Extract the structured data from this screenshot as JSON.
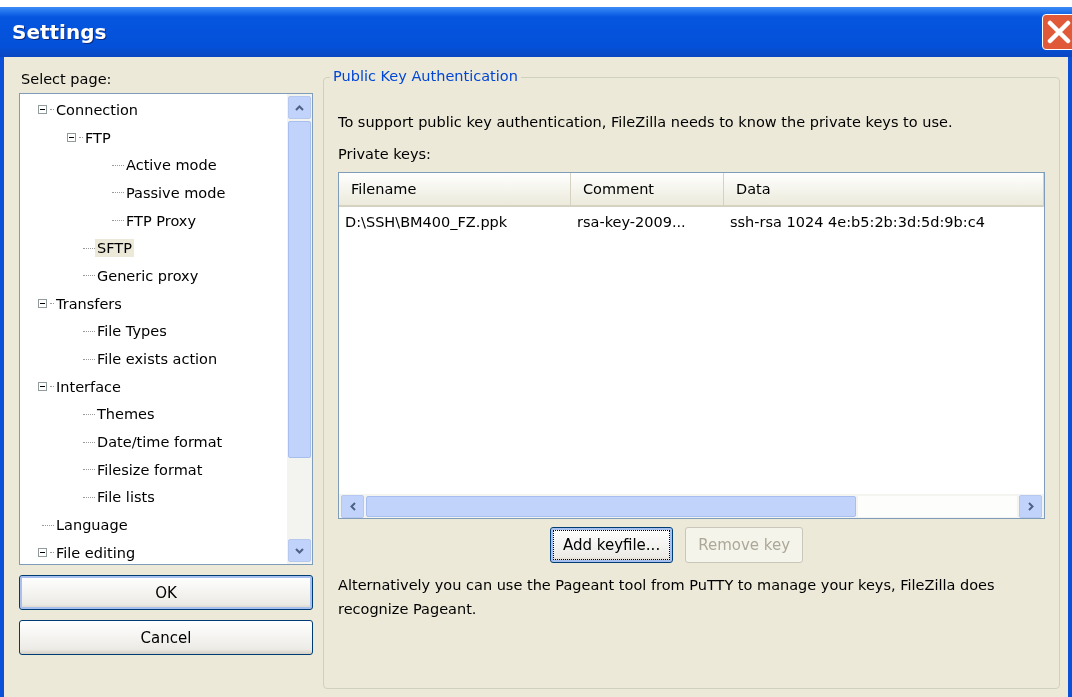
{
  "window": {
    "title": "Settings"
  },
  "sidebar": {
    "label": "Select page:",
    "items": [
      {
        "label": "Connection",
        "expanded": true,
        "selected": false,
        "children": [
          {
            "label": "FTP",
            "expanded": true,
            "selected": false,
            "children": [
              {
                "label": "Active mode",
                "selected": false
              },
              {
                "label": "Passive mode",
                "selected": false
              },
              {
                "label": "FTP Proxy",
                "selected": false
              }
            ]
          },
          {
            "label": "SFTP",
            "selected": true
          },
          {
            "label": "Generic proxy",
            "selected": false
          }
        ]
      },
      {
        "label": "Transfers",
        "expanded": true,
        "selected": false,
        "children": [
          {
            "label": "File Types",
            "selected": false
          },
          {
            "label": "File exists action",
            "selected": false
          }
        ]
      },
      {
        "label": "Interface",
        "expanded": true,
        "selected": false,
        "children": [
          {
            "label": "Themes",
            "selected": false
          },
          {
            "label": "Date/time format",
            "selected": false
          },
          {
            "label": "Filesize format",
            "selected": false
          },
          {
            "label": "File lists",
            "selected": false
          }
        ]
      },
      {
        "label": "Language",
        "selected": false
      },
      {
        "label": "File editing",
        "expanded": true,
        "selected": false
      }
    ]
  },
  "dialog_buttons": [
    {
      "label": "OK",
      "default": true
    },
    {
      "label": "Cancel",
      "default": false
    }
  ],
  "group": {
    "title": "Public Key Authentication",
    "description": "To support public key authentication, FileZilla needs to know the private keys to use.",
    "list_label": "Private keys:",
    "table": {
      "columns": [
        "Filename",
        "Comment",
        "Data"
      ],
      "rows": [
        [
          "D:\\SSH\\BM400_FZ.ppk",
          "rsa-key-2009...",
          "ssh-rsa 1024 4e:b5:2b:3d:5d:9b:c4"
        ]
      ]
    },
    "buttons": [
      {
        "label": "Add keyfile...",
        "disabled": false,
        "default": true
      },
      {
        "label": "Remove key",
        "disabled": true,
        "default": false
      }
    ],
    "note": "Alternatively you can use the Pageant tool from PuTTY to manage your keys, FileZilla does recognize Pageant."
  }
}
